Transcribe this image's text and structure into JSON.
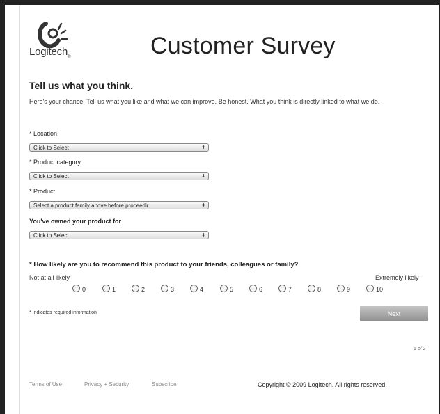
{
  "brand": {
    "name": "Logitech",
    "mark": "®"
  },
  "page_title": "Customer Survey",
  "heading": "Tell us what you think.",
  "intro": "Here's your chance. Tell us what you like and what we can improve. Be honest. What you think is directly linked to what we do.",
  "fields": {
    "location": {
      "label": "* Location",
      "value": "Click to Select"
    },
    "category": {
      "label": "* Product category",
      "value": "Click to Select"
    },
    "product": {
      "label": "* Product",
      "value": "Select a product family above before proceedir"
    },
    "owned": {
      "label": "You've owned your product for",
      "value": "Click to Select"
    }
  },
  "select_arrows": "⬍",
  "nps": {
    "question": "* How likely are you to recommend this product to your friends, colleagues or family?",
    "low_label": "Not at all likely",
    "high_label": "Extremely likely",
    "options": [
      "0",
      "1",
      "2",
      "3",
      "4",
      "5",
      "6",
      "7",
      "8",
      "9",
      "10"
    ]
  },
  "required_note": "* Indicates required information",
  "next_label": "Next",
  "page_indicator": "1 of 2",
  "footer": {
    "terms": "Terms of Use",
    "privacy": "Privacy + Security",
    "subscribe": "Subscribe",
    "copyright": "Copyright © 2009 Logitech. All rights reserved."
  }
}
